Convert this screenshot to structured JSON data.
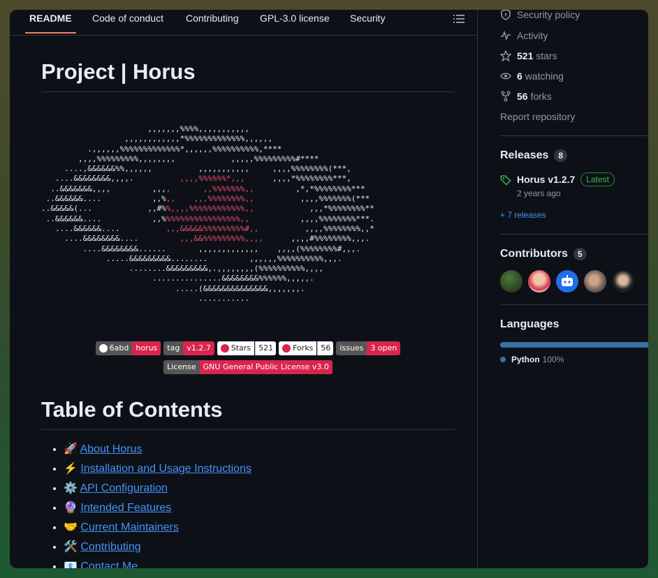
{
  "tabs": [
    "README",
    "Code of conduct",
    "Contributing",
    "GPL-3.0 license",
    "Security"
  ],
  "readme": {
    "title": "Project | Horus",
    "ascii_art": [
      {
        "t": "                       ,,,,,,,%%%%,,,,,,,,,,,"
      },
      {
        "t": "                  ,,,,,,,,,,,,*%%%%%%%%%%%%%,,,,,,"
      },
      {
        "t": "          .,,,,,,%%%%%%%%%%%%%*,,,,,,%%%%%%%%%%,****"
      },
      {
        "t": "        ,,,,%%%%%%%%%,,,,,,,,            ,,,,,%%%%%%%%%#****"
      },
      {
        "t": "     ....,&&&&&&%%,,,,,,          ,,,,,,,,,,,     ,,,,%%%%%%%%(***,"
      },
      {
        "t": "   ....&&&&&&&&,,,,.          ,,,,%%%%%%*,,,      ,,,,*%%%%%%%%***,"
      },
      {
        "t": "  ..&&&&&&&,,,,         ,,,,       ,,%%%%%%%,,         ,*,*%%%%%%%%***"
      },
      {
        "t": " ..&&&&&&....           ,,%,,    ,,,%%%%%%%%,,          ,,,,%%%%%%%(***"
      },
      {
        "t": "..&&&&&(...            ,,#%%,,,,%%%%%%%%%%%%,,            ,,,*%%%%%%%%**"
      },
      {
        "t": " ..&&&&&&....           ,,%%%%%%%%%%%%%%%%%,,           ,,,,%%%%%%%%***."
      },
      {
        "t": "   ....&&&&&&....          ,,,&&&&&%%%%%%%%%#,,          ,,,,%%%%%%%%,,*"
      },
      {
        "t": "     ....&&&&&&&&....         ,,,&&%%%%%%%%%,,,,      ,,,,#%%%%%%%%,,,."
      },
      {
        "t": "         ....&&&&&&&&......       ,,,,,,,,,,,,,    ,,,,(%%%%%%%%#,,,."
      },
      {
        "t": "              .....&&&&&&&&&........         ,,,,,,%%%%%%%%%%,,,."
      },
      {
        "t": "                   ........&&&&&&&&&,.,,,,,,,,(%%%%%%%%%%,,,,"
      },
      {
        "t": "                        ...............&&&&&&&&%%%%%%,,,,,."
      },
      {
        "t": "                             .....(&&&&&&&&&&&&&&,,,,,,,."
      },
      {
        "t": "                                  ..........."
      }
    ],
    "badges_row1": [
      {
        "label": "6abd",
        "value": "horus",
        "style": "gh-red"
      },
      {
        "label": "tag",
        "value": "v1.2.7",
        "style": "grey-red"
      },
      {
        "label": "Stars",
        "value": "521",
        "style": "white"
      },
      {
        "label": "Forks",
        "value": "56",
        "style": "white"
      },
      {
        "label": "issues",
        "value": "3 open",
        "style": "grey-red"
      }
    ],
    "badge_license": {
      "label": "License",
      "value": "GNU General Public License v3.0"
    },
    "toc_title": "Table of Contents",
    "toc": [
      {
        "emoji": "🚀",
        "label": "About Horus"
      },
      {
        "emoji": "⚡",
        "label": "Installation and Usage Instructions"
      },
      {
        "emoji": "⚙️",
        "label": "API Configuration"
      },
      {
        "emoji": "🔮",
        "label": "Intended Features"
      },
      {
        "emoji": "🤝",
        "label": "Current Maintainers"
      },
      {
        "emoji": "🛠️",
        "label": "Contributing"
      },
      {
        "emoji": "📧",
        "label": "Contact Me"
      }
    ]
  },
  "sidebar": {
    "security_policy": "Security policy",
    "activity": "Activity",
    "stars_count": "521",
    "stars_label": "stars",
    "watching_count": "6",
    "watching_label": "watching",
    "forks_count": "56",
    "forks_label": "forks",
    "report": "Report repository",
    "releases_title": "Releases",
    "releases_count": "8",
    "release_name": "Horus v1.2.7",
    "release_badge": "Latest",
    "release_date": "2 years ago",
    "more_releases": "+ 7 releases",
    "contributors_title": "Contributors",
    "contributors_count": "5",
    "languages_title": "Languages",
    "language_name": "Python",
    "language_pct": "100%",
    "language_color": "#3572A5"
  }
}
